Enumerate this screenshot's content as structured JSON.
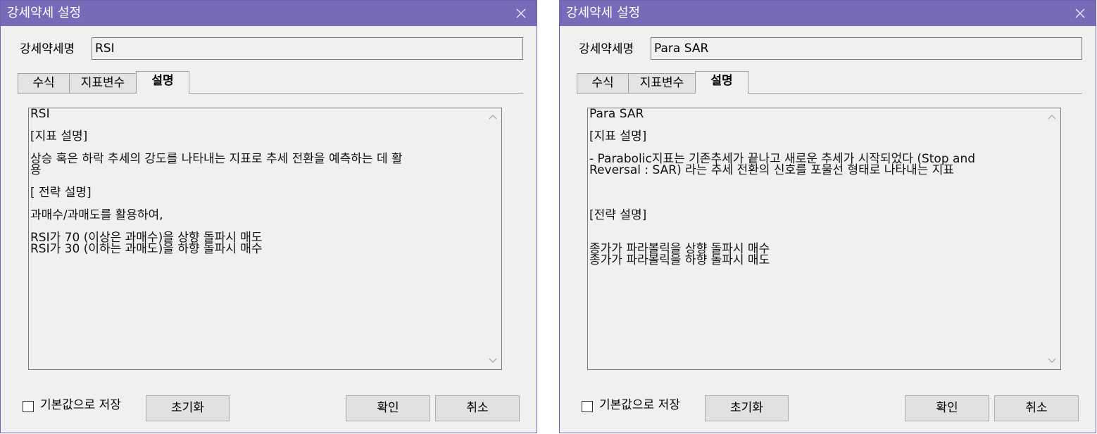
{
  "dialogs": [
    {
      "title": "강세약세 설정",
      "name_label": "강세약세명",
      "name_value": "RSI",
      "tabs": [
        {
          "label": "수식"
        },
        {
          "label": "지표변수"
        },
        {
          "label": "설명"
        }
      ],
      "active_tab": "설명",
      "description_lines": [
        "RSI",
        "",
        "[지표 설명]",
        "",
        "상승 혹은 하락 추세의 강도를 나타내는 지표로 추세 전환을 예측하는 데 활",
        "용",
        "",
        "[ 전략 설명]",
        "",
        "과매수/과매도를 활용하여,",
        "",
        "RSI가 70 (이상은 과매수)을 상향 돌파시 매도",
        "RSI가 30 (이하는 과매도)을 하향 돌파시 매수"
      ],
      "checkbox_label": "기본값으로 저장",
      "checkbox_checked": false,
      "buttons": {
        "reset": "초기화",
        "ok": "확인",
        "cancel": "취소"
      }
    },
    {
      "title": "강세약세 설정",
      "name_label": "강세약세명",
      "name_value": "Para SAR",
      "tabs": [
        {
          "label": "수식"
        },
        {
          "label": "지표변수"
        },
        {
          "label": "설명"
        }
      ],
      "active_tab": "설명",
      "description_lines": [
        "Para SAR",
        "",
        "[지표 설명]",
        "",
        "- Parabolic지표는 기존추세가 끝나고 새로운 추세가 시작되었다 (Stop and",
        "Reversal : SAR) 라는 추세 전환의 신호를 포물선 형태로 나타내는 지표",
        "",
        "",
        "",
        "[전략 설명]",
        "",
        "",
        "종가가 파라볼릭을 상향 돌파시 매수",
        "종가가 파라볼릭을 하향 돌파시 매도"
      ],
      "checkbox_label": "기본값으로 저장",
      "checkbox_checked": false,
      "buttons": {
        "reset": "초기화",
        "ok": "확인",
        "cancel": "취소"
      }
    }
  ],
  "colors": {
    "titlebar": "#776ab9",
    "dialog_bg": "#f0f0f0",
    "button_bg": "#e1e1e1"
  },
  "icons": {
    "close": "close-icon",
    "scroll_up": "chevron-up-icon",
    "scroll_down": "chevron-down-icon"
  }
}
